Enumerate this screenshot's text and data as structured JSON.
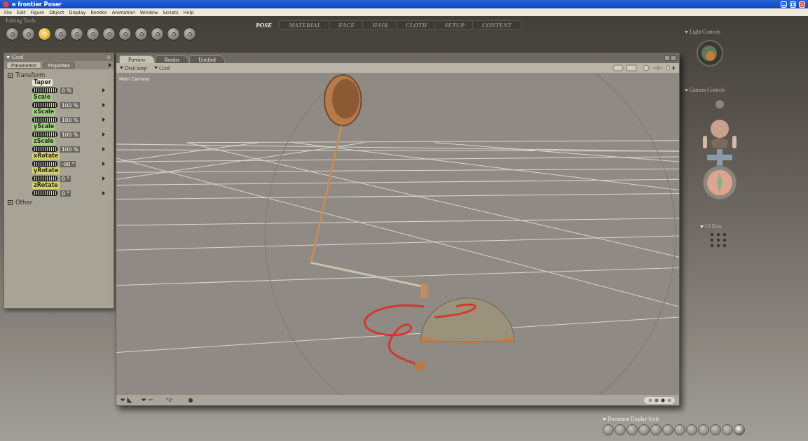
{
  "window": {
    "title": "e frontier Poser"
  },
  "menu": [
    "File",
    "Edit",
    "Figure",
    "Object",
    "Display",
    "Render",
    "Animation",
    "Window",
    "Scripts",
    "Help"
  ],
  "editing_tools": {
    "label": "Editing Tools",
    "tools": [
      {
        "selected": false
      },
      {
        "selected": false
      },
      {
        "selected": true
      },
      {
        "selected": false
      },
      {
        "selected": false
      },
      {
        "selected": false
      },
      {
        "selected": false
      },
      {
        "selected": false
      },
      {
        "selected": false
      },
      {
        "selected": false
      },
      {
        "selected": false
      },
      {
        "selected": false
      }
    ]
  },
  "room_tabs": [
    {
      "label": "POSE",
      "selected": true
    },
    {
      "label": "MATERIAL",
      "selected": false
    },
    {
      "label": "FACE",
      "selected": false
    },
    {
      "label": "HAIR",
      "selected": false
    },
    {
      "label": "CLOTH",
      "selected": false
    },
    {
      "label": "SETUP",
      "selected": false
    },
    {
      "label": "CONTENT",
      "selected": false
    }
  ],
  "parameters_panel": {
    "title": "Cord",
    "tabs": [
      {
        "label": "Parameters",
        "selected": true
      },
      {
        "label": "Properties",
        "selected": false
      }
    ],
    "groups": [
      {
        "label": "Transform",
        "params": [
          {
            "name": "Taper",
            "value": "0 %",
            "color": "#e8e4d8"
          },
          {
            "name": "Scale",
            "value": "100 %",
            "color": "#9ed47c"
          },
          {
            "name": "xScale",
            "value": "100 %",
            "color": "#9ed47c"
          },
          {
            "name": "yScale",
            "value": "100 %",
            "color": "#9ed47c"
          },
          {
            "name": "zScale",
            "value": "100 %",
            "color": "#9ed47c"
          },
          {
            "name": "xRotate",
            "value": "-90 °",
            "color": "#d6d46a"
          },
          {
            "name": "yRotate",
            "value": "0 °",
            "color": "#d6d46a"
          },
          {
            "name": "zRotate",
            "value": "0 °",
            "color": "#d6d46a"
          }
        ]
      },
      {
        "label": "Other"
      }
    ]
  },
  "document": {
    "tabs": [
      {
        "label": "Preview",
        "selected": true
      },
      {
        "label": "Render",
        "selected": false
      },
      {
        "label": "Untitled",
        "selected": false
      }
    ],
    "menus": [
      "Desk lamp",
      "Cord"
    ],
    "camera_label": "Main Camera"
  },
  "light_controls": {
    "label": "Light Controls"
  },
  "camera_controls": {
    "label": "Camera Controls"
  },
  "ui_dots": {
    "label": "UI Dots"
  },
  "display_style": {
    "label": "Document Display Style",
    "styles": [
      {
        "selected": false
      },
      {
        "selected": false
      },
      {
        "selected": false
      },
      {
        "selected": false
      },
      {
        "selected": false
      },
      {
        "selected": false
      },
      {
        "selected": false
      },
      {
        "selected": false
      },
      {
        "selected": false
      },
      {
        "selected": false
      },
      {
        "selected": false
      },
      {
        "selected": true
      }
    ]
  }
}
